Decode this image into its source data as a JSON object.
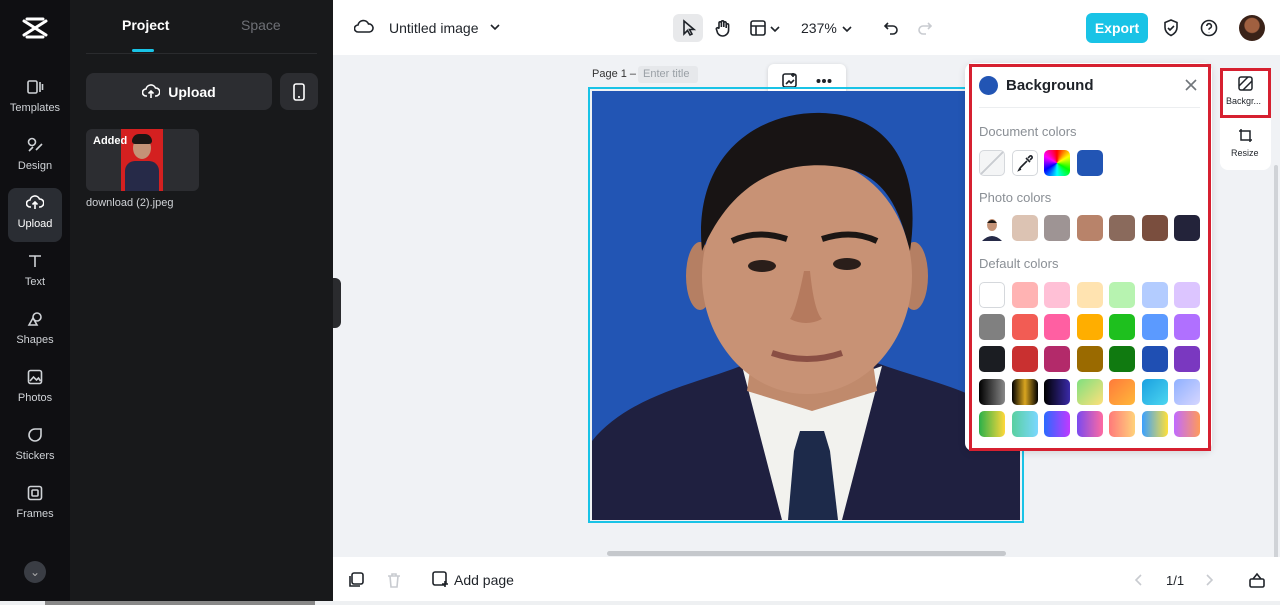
{
  "rail": {
    "items": [
      {
        "label": "Templates",
        "icon": "templates-icon"
      },
      {
        "label": "Design",
        "icon": "design-icon"
      },
      {
        "label": "Upload",
        "icon": "upload-icon",
        "active": true
      },
      {
        "label": "Text",
        "icon": "text-icon"
      },
      {
        "label": "Shapes",
        "icon": "shapes-icon"
      },
      {
        "label": "Photos",
        "icon": "photos-icon"
      },
      {
        "label": "Stickers",
        "icon": "stickers-icon"
      },
      {
        "label": "Frames",
        "icon": "frames-icon"
      }
    ]
  },
  "panel": {
    "tabs": {
      "project": "Project",
      "space": "Space"
    },
    "upload_label": "Upload",
    "asset": {
      "badge": "Added",
      "filename": "download (2).jpeg"
    }
  },
  "topbar": {
    "title": "Untitled image",
    "zoom": "237%",
    "export_label": "Export"
  },
  "canvas": {
    "page_label": "Page 1 –",
    "title_placeholder": "Enter title"
  },
  "background_panel": {
    "title": "Background",
    "sections": {
      "document": "Document colors",
      "photo": "Photo colors",
      "default": "Default colors"
    },
    "document_colors": [
      "transparent",
      "eyedropper",
      "rainbow",
      "#2255b4"
    ],
    "photo_colors": [
      "photo-thumbnail",
      "#dcc3b3",
      "#9e9494",
      "#b8836a",
      "#8a6a5c",
      "#7a4e3e",
      "#23233a"
    ],
    "default_colors": [
      [
        "#ffffff",
        "#ffb3b3",
        "#ffc0d6",
        "#ffe3b0",
        "#b7f3b0",
        "#b3ccff",
        "#dcc5ff"
      ],
      [
        "#808080",
        "#f25c54",
        "#ff5fa2",
        "#ffae00",
        "#1ec01e",
        "#5b9aff",
        "#b070ff"
      ],
      [
        "#1b1d22",
        "#c93030",
        "#b32a6a",
        "#9a6a00",
        "#107a10",
        "#1f4fb3",
        "#7a38c0"
      ]
    ]
  },
  "side_tabs": {
    "background": "Backgr...",
    "resize": "Resize"
  },
  "bottombar": {
    "add_page": "Add page",
    "page_count": "1/1"
  },
  "colors": {
    "accent": "#19c3e6",
    "highlight": "#d62030",
    "canvas_bg": "#2255b4"
  }
}
